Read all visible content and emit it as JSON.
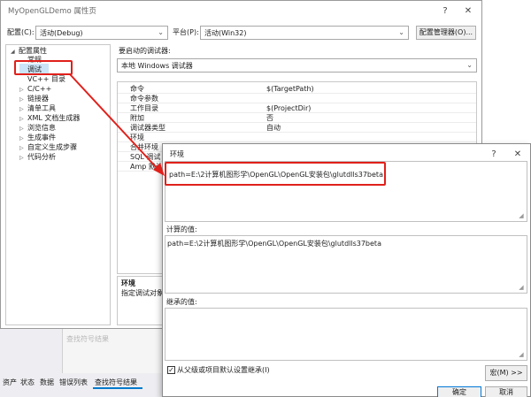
{
  "window": {
    "title": "MyOpenGLDemo 属性页",
    "help_glyph": "?",
    "close_glyph": "✕"
  },
  "config_bar": {
    "configuration_label": "配置(C):",
    "configuration_value": "活动(Debug)",
    "platform_label": "平台(P):",
    "platform_value": "活动(Win32)",
    "manager_button": "配置管理器(O)..."
  },
  "tree": {
    "root": "配置属性",
    "items": [
      {
        "label": "常规",
        "expandable": false
      },
      {
        "label": "调试",
        "expandable": false,
        "selected": true
      },
      {
        "label": "VC++ 目录",
        "expandable": false
      },
      {
        "label": "C/C++",
        "expandable": true
      },
      {
        "label": "链接器",
        "expandable": true
      },
      {
        "label": "清单工具",
        "expandable": true
      },
      {
        "label": "XML 文档生成器",
        "expandable": true
      },
      {
        "label": "浏览信息",
        "expandable": true
      },
      {
        "label": "生成事件",
        "expandable": true
      },
      {
        "label": "自定义生成步骤",
        "expandable": true
      },
      {
        "label": "代码分析",
        "expandable": true
      }
    ]
  },
  "debugger": {
    "launch_label": "要启动的调试器:",
    "launch_value": "本地 Windows 调试器"
  },
  "properties": [
    {
      "key": "命令",
      "value": "$(TargetPath)"
    },
    {
      "key": "命令参数",
      "value": ""
    },
    {
      "key": "工作目录",
      "value": "$(ProjectDir)"
    },
    {
      "key": "附加",
      "value": "否"
    },
    {
      "key": "调试器类型",
      "value": "自动"
    },
    {
      "key": "环境",
      "value": ""
    },
    {
      "key": "合并环境",
      "value": ""
    },
    {
      "key": "SQL 调试",
      "value": ""
    },
    {
      "key": "Amp 默认加",
      "value": ""
    }
  ],
  "description": {
    "title": "环境",
    "text": "指定调试对象的"
  },
  "bottom_panel": {
    "tabs": [
      "资产",
      "状态",
      "数据",
      "错误列表",
      "查找符号结果"
    ],
    "active_tab": "查找符号结果",
    "faded_label": "查找符号结果"
  },
  "env_dialog": {
    "title": "环境",
    "help_glyph": "?",
    "close_glyph": "✕",
    "value": "path=E:\\2计算机图形学\\OpenGL\\OpenGL安装包\\glutdlls37beta",
    "computed_label": "计算的值:",
    "computed_value": "path=E:\\2计算机图形学\\OpenGL\\OpenGL安装包\\glutdlls37beta",
    "inherited_label": "继承的值:",
    "inherit_checkbox_label": "从父级或项目默认设置继承(I)",
    "inherit_checked": true,
    "macro_button": "宏(M) >>",
    "ok_button": "确定",
    "cancel_button": "取消"
  },
  "annotation_color": "#e0201b"
}
